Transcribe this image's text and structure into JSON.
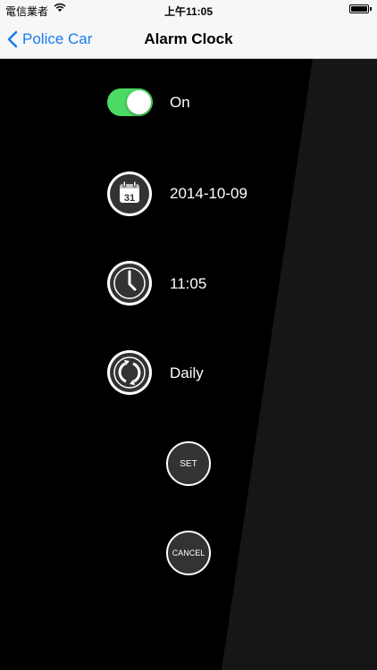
{
  "status_bar": {
    "carrier": "電信業者",
    "time": "上午11:05"
  },
  "nav": {
    "back_label": "Police Car",
    "title": "Alarm Clock"
  },
  "alarm": {
    "enabled": true,
    "toggle_label": "On",
    "date": "2014-10-09",
    "calendar_day": "31",
    "time": "11:05",
    "repeat": "Daily"
  },
  "buttons": {
    "set": "SET",
    "cancel": "CANCEL"
  },
  "colors": {
    "accent": "#1a7bf2",
    "toggle_on": "#4cd964"
  }
}
